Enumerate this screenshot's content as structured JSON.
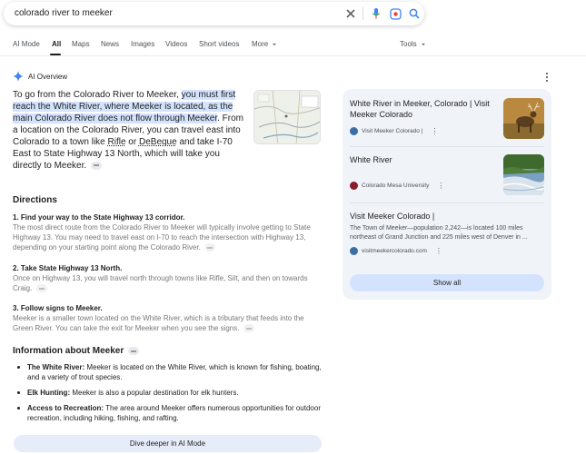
{
  "search": {
    "query": "colorado river to meeker",
    "icons": [
      "close-icon",
      "microphone-icon",
      "lens-icon",
      "search-icon"
    ]
  },
  "tabs": [
    {
      "label": "AI Mode"
    },
    {
      "label": "All"
    },
    {
      "label": "Maps"
    },
    {
      "label": "News"
    },
    {
      "label": "Images"
    },
    {
      "label": "Videos"
    },
    {
      "label": "Short videos"
    },
    {
      "label": "More"
    }
  ],
  "tools_label": "Tools",
  "ai_overview": {
    "label": "AI Overview",
    "intro": {
      "p1": "To go from the Colorado River to Meeker, ",
      "hl": "you must first reach the White River, where Meeker is located, as the main Colorado River does not flow through Meeker",
      "p2": ". From a location on the Colorado River, you can travel east into Colorado to a town like ",
      "rifle": "Rifle",
      "p3": " or ",
      "debeque": "DeBeque",
      "p4": " and take I-70 East to State Highway 13 North, which will take you directly to Meeker."
    },
    "directions_heading": "Directions",
    "steps": [
      {
        "title": "1. Find your way to the State Highway 13 corridor.",
        "body": "The most direct route from the Colorado River to Meeker will typically involve getting to State Highway 13. You may need to travel east on I-70 to reach the intersection with Highway 13, depending on your starting point along the Colorado River."
      },
      {
        "title": "2. Take State Highway 13 North.",
        "body": "Once on Highway 13, you will travel north through towns like Rifle, Silt, and then on towards Craig."
      },
      {
        "title": "3. Follow signs to Meeker.",
        "body": "Meeker is a smaller town located on the White River, which is a tributary that feeds into the Green River. You can take the exit for Meeker when you see the signs."
      }
    ],
    "info_heading": "Information about Meeker",
    "bullets": [
      {
        "term": "The White River:",
        "text": " Meeker is located on the White River, which is known for fishing, boating, and a variety of trout species."
      },
      {
        "term": "Elk Hunting:",
        "text": " Meeker is also a popular destination for elk hunters."
      },
      {
        "term": "Access to Recreation:",
        "text": " The area around Meeker offers numerous opportunities for outdoor recreation, including hiking, fishing, and rafting."
      }
    ],
    "dive_button": "Dive deeper in AI Mode"
  },
  "sources": [
    {
      "title": "White River in Meeker, Colorado | Visit Meeker Colorado",
      "site": "Visit Meeker Colorado |",
      "favicon_color": "#3b6ea5",
      "thumb": "elk-photo"
    },
    {
      "title": "White River",
      "site": "Colorado Mesa University",
      "favicon_color": "#8a1c2b",
      "thumb": "river-photo"
    },
    {
      "title": "Visit Meeker Colorado |",
      "desc": "The Town of Meeker—population 2,242—is located 100 miles northeast of Grand Junction and 225 miles west of Denver in ...",
      "site": "visitmeekercolorado.com",
      "favicon_color": "#3b6ea5"
    }
  ],
  "show_all": "Show all",
  "colors": {
    "accent": "#1a73e8",
    "highlight": "#d3e3fd",
    "panel": "#f0f4f9"
  }
}
